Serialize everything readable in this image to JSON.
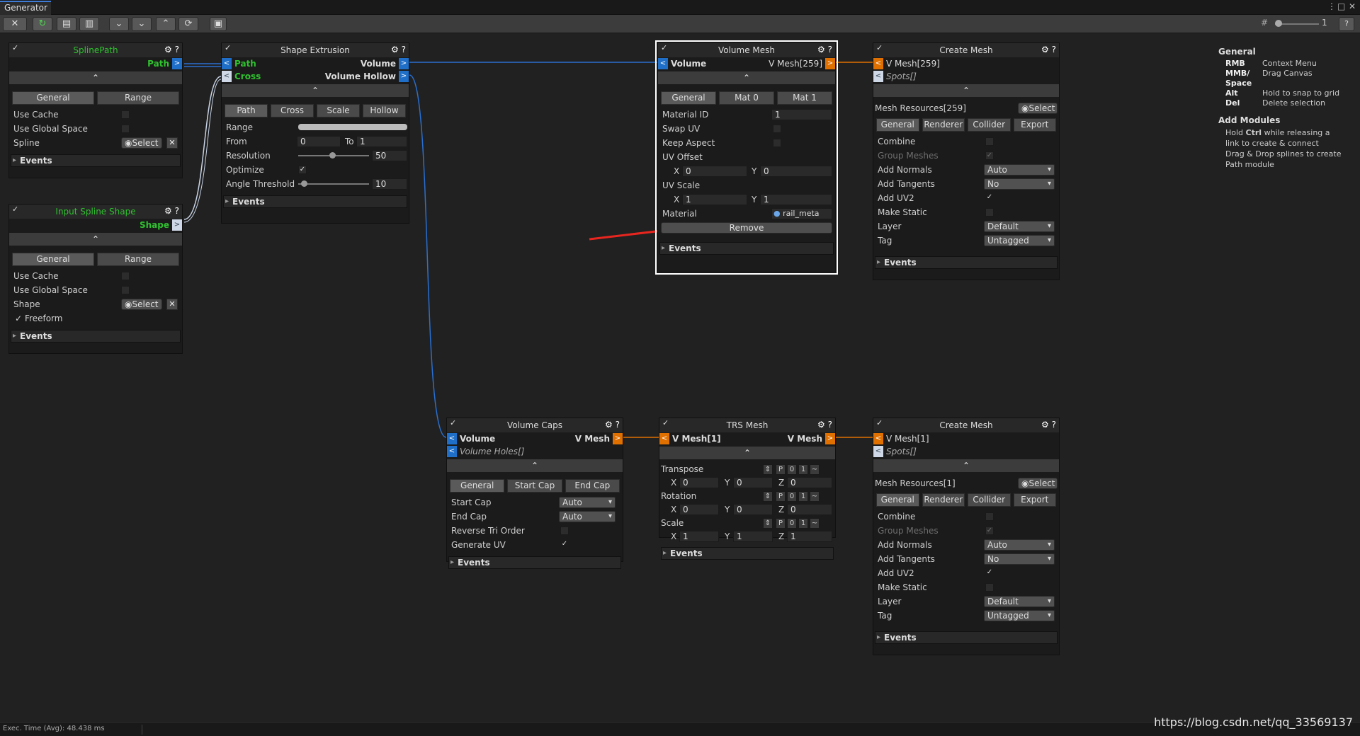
{
  "window": {
    "tab": "Generator",
    "menu_icon": "⋮",
    "maximize_icon": "□",
    "close_icon": "✕"
  },
  "toolbar": {
    "zoom_value": "1"
  },
  "nodes": {
    "spline_path": {
      "title": "SplinePath",
      "out": "Path",
      "tabs": [
        "General",
        "Range"
      ],
      "use_cache": "Use Cache",
      "use_global_space": "Use Global Space",
      "spline": "Spline",
      "select": "Select",
      "events": "Events"
    },
    "input_spline_shape": {
      "title": "Input Spline Shape",
      "out": "Shape",
      "tabs": [
        "General",
        "Range"
      ],
      "use_cache": "Use Cache",
      "use_global_space": "Use Global Space",
      "shape": "Shape",
      "select": "Select",
      "freeform": "Freeform",
      "events": "Events"
    },
    "shape_extrusion": {
      "title": "Shape Extrusion",
      "in_path": "Path",
      "in_cross": "Cross",
      "out_volume": "Volume",
      "out_volume_hollow": "Volume Hollow",
      "tabs": [
        "Path",
        "Cross",
        "Scale",
        "Hollow"
      ],
      "range": "Range",
      "from": "From",
      "from_val": "0",
      "to": "To",
      "to_val": "1",
      "resolution": "Resolution",
      "resolution_val": "50",
      "optimize": "Optimize",
      "angle_threshold": "Angle Threshold",
      "angle_val": "10",
      "events": "Events"
    },
    "volume_mesh": {
      "title": "Volume Mesh",
      "in_volume": "Volume",
      "out": "V Mesh[259]",
      "tabs": [
        "General",
        "Mat 0",
        "Mat 1"
      ],
      "material_id": "Material ID",
      "material_id_val": "1",
      "swap_uv": "Swap UV",
      "keep_aspect": "Keep Aspect",
      "uv_offset": "UV Offset",
      "uv_offset_x": "0",
      "uv_offset_y": "0",
      "uv_scale": "UV Scale",
      "uv_scale_x": "1",
      "uv_scale_y": "1",
      "material": "Material",
      "material_val": "rail_meta",
      "remove": "Remove",
      "events": "Events"
    },
    "create_mesh_1": {
      "title": "Create Mesh",
      "in": "V Mesh[259]",
      "in_spots": "Spots[]",
      "resources": "Mesh Resources[259]",
      "select": "Select",
      "tabs": [
        "General",
        "Renderer",
        "Collider",
        "Export"
      ],
      "combine": "Combine",
      "group_meshes": "Group Meshes",
      "add_normals": "Add Normals",
      "add_normals_val": "Auto",
      "add_tangents": "Add Tangents",
      "add_tangents_val": "No",
      "add_uv2": "Add UV2",
      "make_static": "Make Static",
      "layer": "Layer",
      "layer_val": "Default",
      "tag": "Tag",
      "tag_val": "Untagged",
      "events": "Events"
    },
    "volume_caps": {
      "title": "Volume Caps",
      "in_volume": "Volume",
      "in_holes": "Volume Holes[]",
      "out": "V Mesh",
      "tabs": [
        "General",
        "Start Cap",
        "End Cap"
      ],
      "start_cap": "Start Cap",
      "start_cap_val": "Auto",
      "end_cap": "End Cap",
      "end_cap_val": "Auto",
      "reverse_tri": "Reverse Tri Order",
      "generate_uv": "Generate UV",
      "events": "Events"
    },
    "trs_mesh": {
      "title": "TRS Mesh",
      "in": "V Mesh[1]",
      "out": "V Mesh",
      "transpose": "Transpose",
      "rotation": "Rotation",
      "scale": "Scale",
      "btn_p": "P",
      "btn_0": "0",
      "btn_1": "1",
      "btn_tilde": "~",
      "t_x": "0",
      "t_y": "0",
      "t_z": "0",
      "r_x": "0",
      "r_y": "0",
      "r_z": "0",
      "s_x": "1",
      "s_y": "1",
      "s_z": "1",
      "events": "Events"
    },
    "create_mesh_2": {
      "title": "Create Mesh",
      "in": "V Mesh[1]",
      "in_spots": "Spots[]",
      "resources": "Mesh Resources[1]",
      "select": "Select",
      "tabs": [
        "General",
        "Renderer",
        "Collider",
        "Export"
      ],
      "combine": "Combine",
      "group_meshes": "Group Meshes",
      "add_normals": "Add Normals",
      "add_normals_val": "Auto",
      "add_tangents": "Add Tangents",
      "add_tangents_val": "No",
      "add_uv2": "Add UV2",
      "make_static": "Make Static",
      "layer": "Layer",
      "layer_val": "Default",
      "tag": "Tag",
      "tag_val": "Untagged",
      "events": "Events"
    }
  },
  "axis": {
    "x": "X",
    "y": "Y",
    "z": "Z"
  },
  "help": {
    "general_title": "General",
    "keys": [
      {
        "k": "RMB",
        "v": "Context Menu"
      },
      {
        "k": "MMB/",
        "v": "Drag Canvas"
      },
      {
        "k": "Space",
        "v": ""
      },
      {
        "k": "Alt",
        "v": "Hold to snap to grid"
      },
      {
        "k": "Del",
        "v": "Delete selection"
      }
    ],
    "modules_title": "Add Modules",
    "modules_line1_pre": "Hold ",
    "modules_line1_key": "Ctrl",
    "modules_line1_post": " while releasing a",
    "modules_line2": "link to create & connect",
    "modules_line3": "Drag & Drop splines to create",
    "modules_line4": "Path module"
  },
  "status": {
    "exec_time": "Exec. Time (Avg): 48.438 ms"
  },
  "watermark": "https://blog.csdn.net/qq_33569137",
  "colors": {
    "volume_slot": "#1f6fc8",
    "mesh_slot": "#e07000",
    "spots_slot": "#cfd8e6",
    "wire": "#2a6fd0",
    "accent_green": "#2fc22f",
    "selection": "#ffffff",
    "annotation_arrow": "#e8261f"
  }
}
